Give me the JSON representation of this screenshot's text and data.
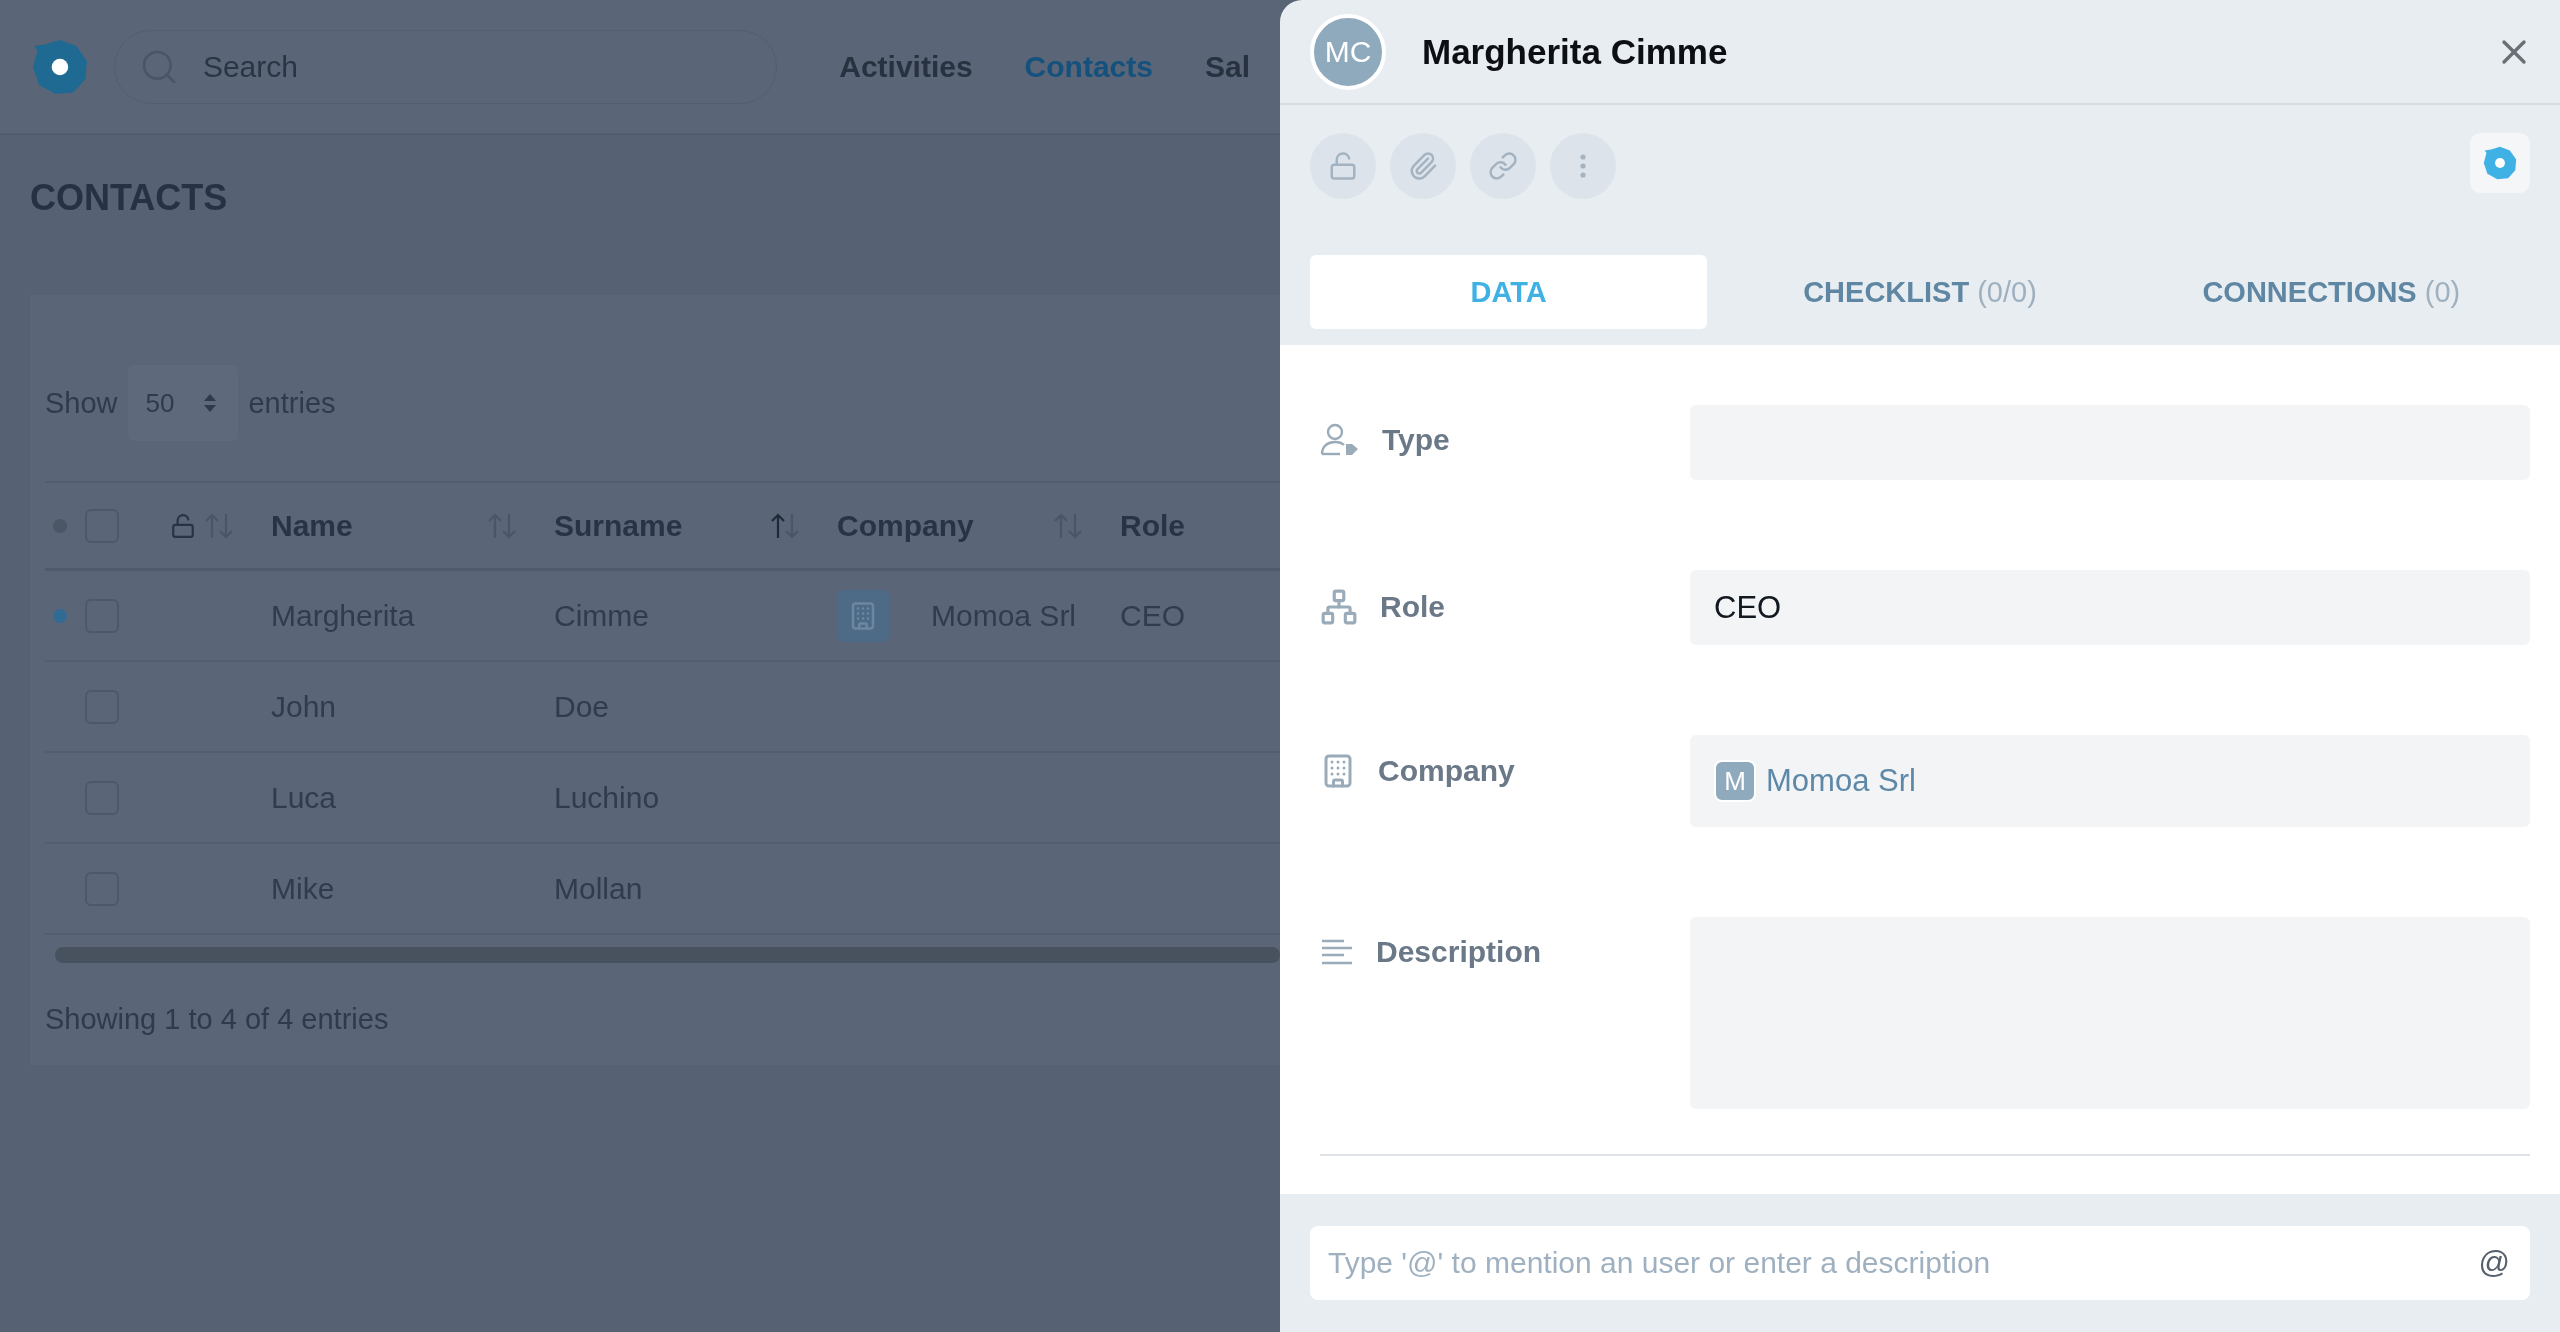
{
  "topbar": {
    "search": {
      "placeholder": "Search"
    },
    "nav": [
      {
        "label": "Activities",
        "selected": false
      },
      {
        "label": "Contacts",
        "selected": true
      },
      {
        "label": "Sal",
        "selected": false
      }
    ]
  },
  "page_title": "CONTACTS",
  "length_menu": {
    "prefix": "Show",
    "value": "50",
    "suffix": "entries"
  },
  "table": {
    "select_all_checked": false,
    "columns": [
      {
        "kind": "lock",
        "sorted": false
      },
      {
        "kind": "text",
        "label": "Name",
        "sorted": false
      },
      {
        "kind": "text",
        "label": "Surname",
        "sorted": true
      },
      {
        "kind": "text",
        "label": "Company",
        "sorted": false
      },
      {
        "kind": "text",
        "label": "Role"
      }
    ],
    "rows": [
      {
        "flagged": true,
        "checked": false,
        "name": "Margherita",
        "surname": "Cimme",
        "company": "Momoa Srl",
        "role": "CEO"
      },
      {
        "flagged": false,
        "checked": false,
        "name": "John",
        "surname": "Doe"
      },
      {
        "flagged": false,
        "checked": false,
        "name": "Luca",
        "surname": "Luchino"
      },
      {
        "flagged": false,
        "checked": false,
        "name": "Mike",
        "surname": "Mollan"
      }
    ]
  },
  "table_info": "Showing 1 to 4 of 4 entries",
  "panel": {
    "avatar": "MC",
    "title": "Margherita Cimme",
    "tabs": [
      {
        "label": "DATA",
        "selected": true
      },
      {
        "label": "CHECKLIST",
        "count": "(0/0)",
        "selected": false
      },
      {
        "label": "CONNECTIONS",
        "count": "(0)",
        "selected": false
      }
    ],
    "fields": [
      {
        "kind": "text",
        "label": "Type"
      },
      {
        "kind": "text",
        "label": "Role",
        "value": "CEO"
      },
      {
        "kind": "company",
        "label": "Company",
        "initial": "M",
        "value": "Momoa Srl"
      },
      {
        "kind": "textarea",
        "label": "Description"
      }
    ],
    "comment": {
      "placeholder": "Type '@' to mention an user or enter a description",
      "button": "@"
    }
  }
}
